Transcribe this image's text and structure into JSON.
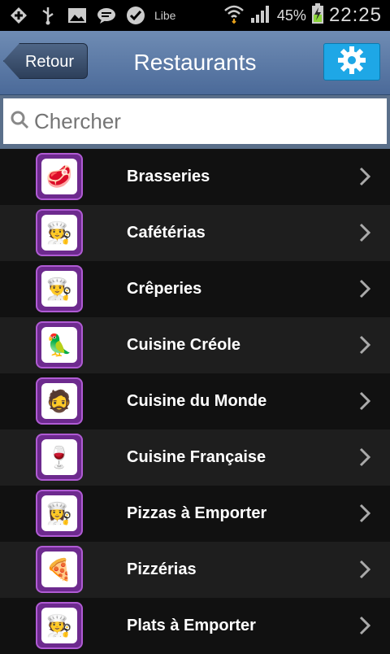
{
  "status_bar": {
    "icons": [
      "add-icon",
      "usb-icon",
      "image-icon",
      "chat-icon",
      "check-icon",
      "libe-icon"
    ],
    "libe_text": "Libe",
    "battery": "45%",
    "time": "22:25"
  },
  "header": {
    "back_label": "Retour",
    "title": "Restaurants",
    "settings_icon": "gear-icon"
  },
  "search": {
    "placeholder": "Chercher"
  },
  "categories": [
    {
      "label": "Brasseries",
      "icon": "🥩"
    },
    {
      "label": "Cafétérias",
      "icon": "🧑‍🍳"
    },
    {
      "label": "Crêperies",
      "icon": "👨‍🍳"
    },
    {
      "label": "Cuisine Créole",
      "icon": "🦜"
    },
    {
      "label": "Cuisine du Monde",
      "icon": "🧔"
    },
    {
      "label": "Cuisine Française",
      "icon": "🍷"
    },
    {
      "label": "Pizzas à Emporter",
      "icon": "👩‍🍳"
    },
    {
      "label": "Pizzérias",
      "icon": "🍕"
    },
    {
      "label": "Plats à Emporter",
      "icon": "🧑‍🍳"
    }
  ],
  "colors": {
    "header_top": "#6f8cb4",
    "header_bottom": "#4b6a99",
    "settings_blue": "#1ea7e6",
    "thumb_purple": "#6d2a8e"
  }
}
